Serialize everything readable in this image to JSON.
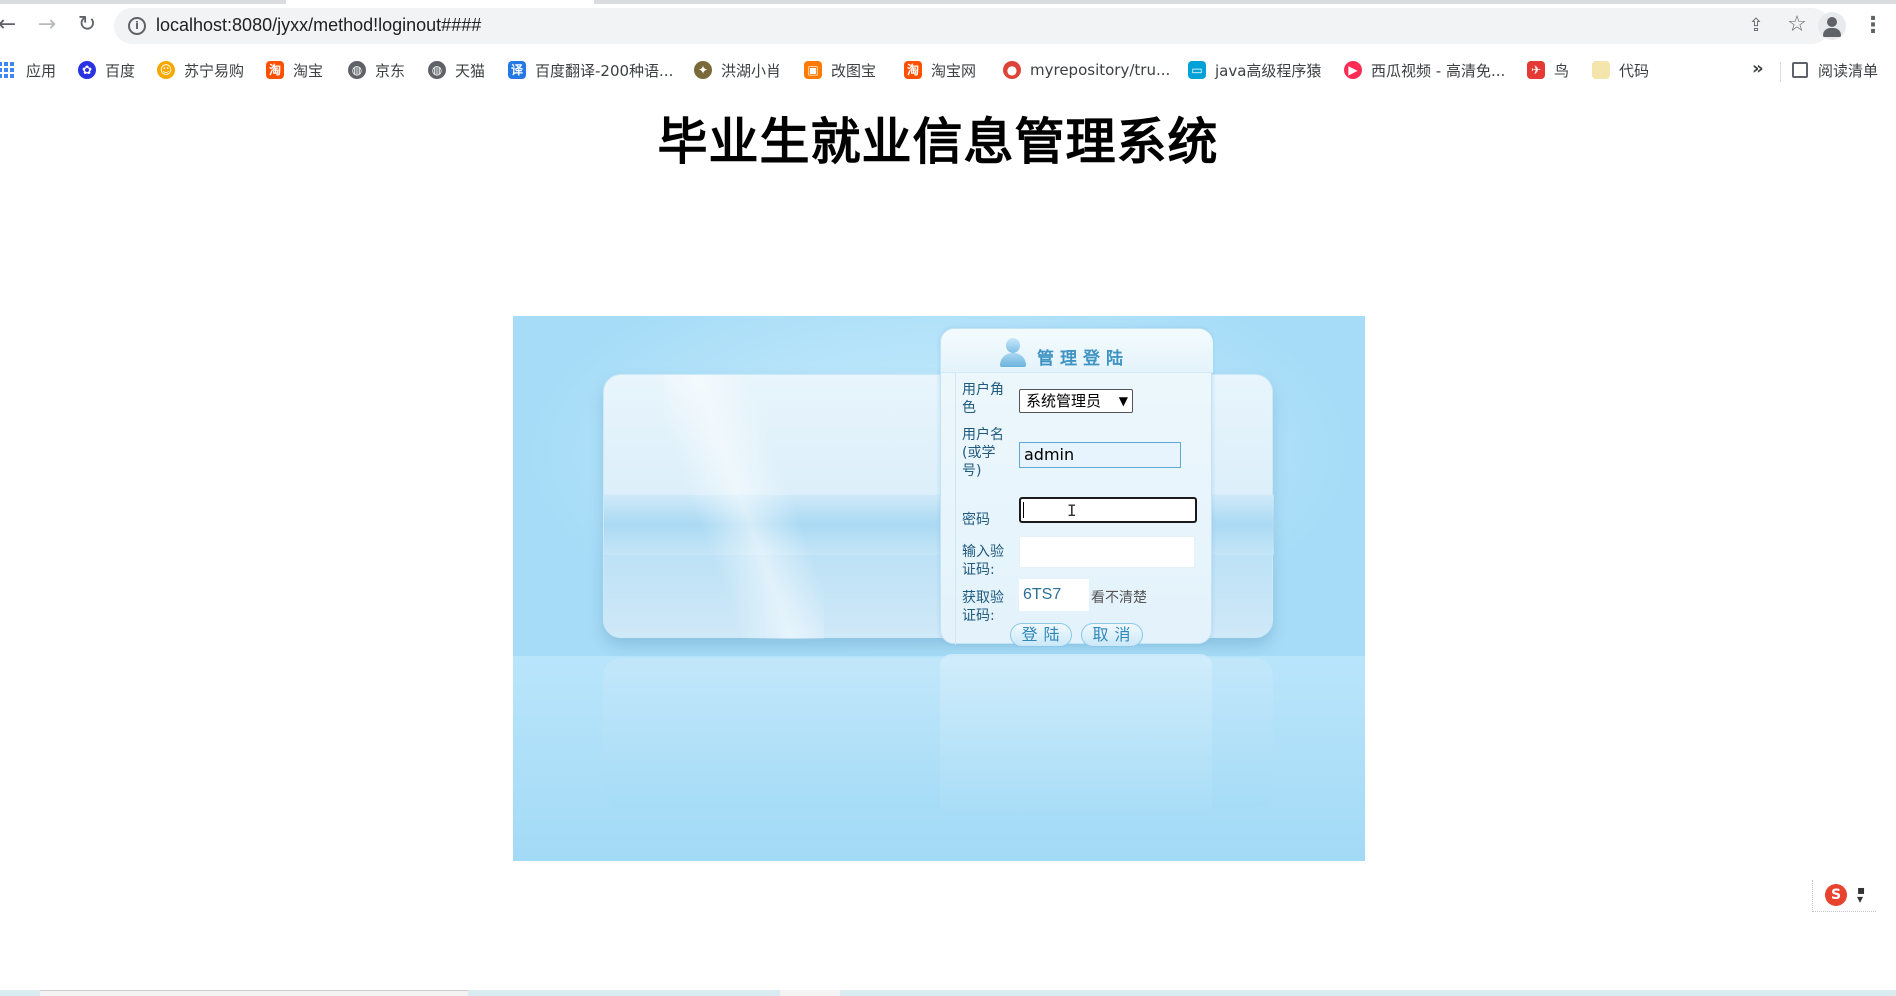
{
  "browser": {
    "url": "localhost:8080/jyxx/method!loginout####",
    "bookmarks": [
      {
        "label": "应用",
        "icon": "apps-icon"
      },
      {
        "label": "百度",
        "icon": "baidu-icon",
        "color": "#2932e1"
      },
      {
        "label": "苏宁易购",
        "icon": "suning-icon",
        "color": "#f6a800"
      },
      {
        "label": "淘宝",
        "icon": "taobao-icon",
        "color": "#ff5000"
      },
      {
        "label": "京东",
        "icon": "globe-icon",
        "color": "#5f6368"
      },
      {
        "label": "天猫",
        "icon": "globe-icon",
        "color": "#5f6368"
      },
      {
        "label": "百度翻译-200种语...",
        "icon": "translate-icon",
        "color": "#2577e3"
      },
      {
        "label": "洪湖小肖",
        "icon": "bird-icon",
        "color": "#7a6a3a"
      },
      {
        "label": "改图宝",
        "icon": "gaitubao-icon",
        "color": "#ff7a00"
      },
      {
        "label": "淘宝网",
        "icon": "taobao-icon",
        "color": "#ff5000"
      },
      {
        "label": "myrepository/tru...",
        "icon": "chrome-icon",
        "color": "#db4437"
      },
      {
        "label": "java高级程序猿",
        "icon": "bilibili-icon",
        "color": "#00a1d6"
      },
      {
        "label": "西瓜视频 - 高清免...",
        "icon": "xigua-icon",
        "color": "#fe2c55"
      },
      {
        "label": "鸟",
        "icon": "bird-red-icon",
        "color": "#e53935"
      },
      {
        "label": "代码",
        "icon": "folder-icon",
        "color": "#f3e5ab"
      }
    ],
    "more": "»",
    "reading_list": "阅读清单"
  },
  "page": {
    "title": "毕业生就业信息管理系统"
  },
  "login": {
    "header": "管理登陆",
    "role_label": "用户角色",
    "role_value": "系统管理员",
    "username_label": "用户名(或学号)",
    "username_value": "admin",
    "password_label": "密码",
    "password_value": "",
    "captcha_input_label": "输入验证码:",
    "captcha_input_value": "",
    "captcha_label": "获取验证码:",
    "captcha_text": "6TS7",
    "captcha_refresh": "看不清楚",
    "login_button": "登陆",
    "cancel_button": "取消"
  },
  "ime": {
    "logo": "S"
  },
  "colors": {
    "background_scene": "#a6dcf7",
    "panel_title": "#3f94c4",
    "label": "#1f5a7e"
  }
}
